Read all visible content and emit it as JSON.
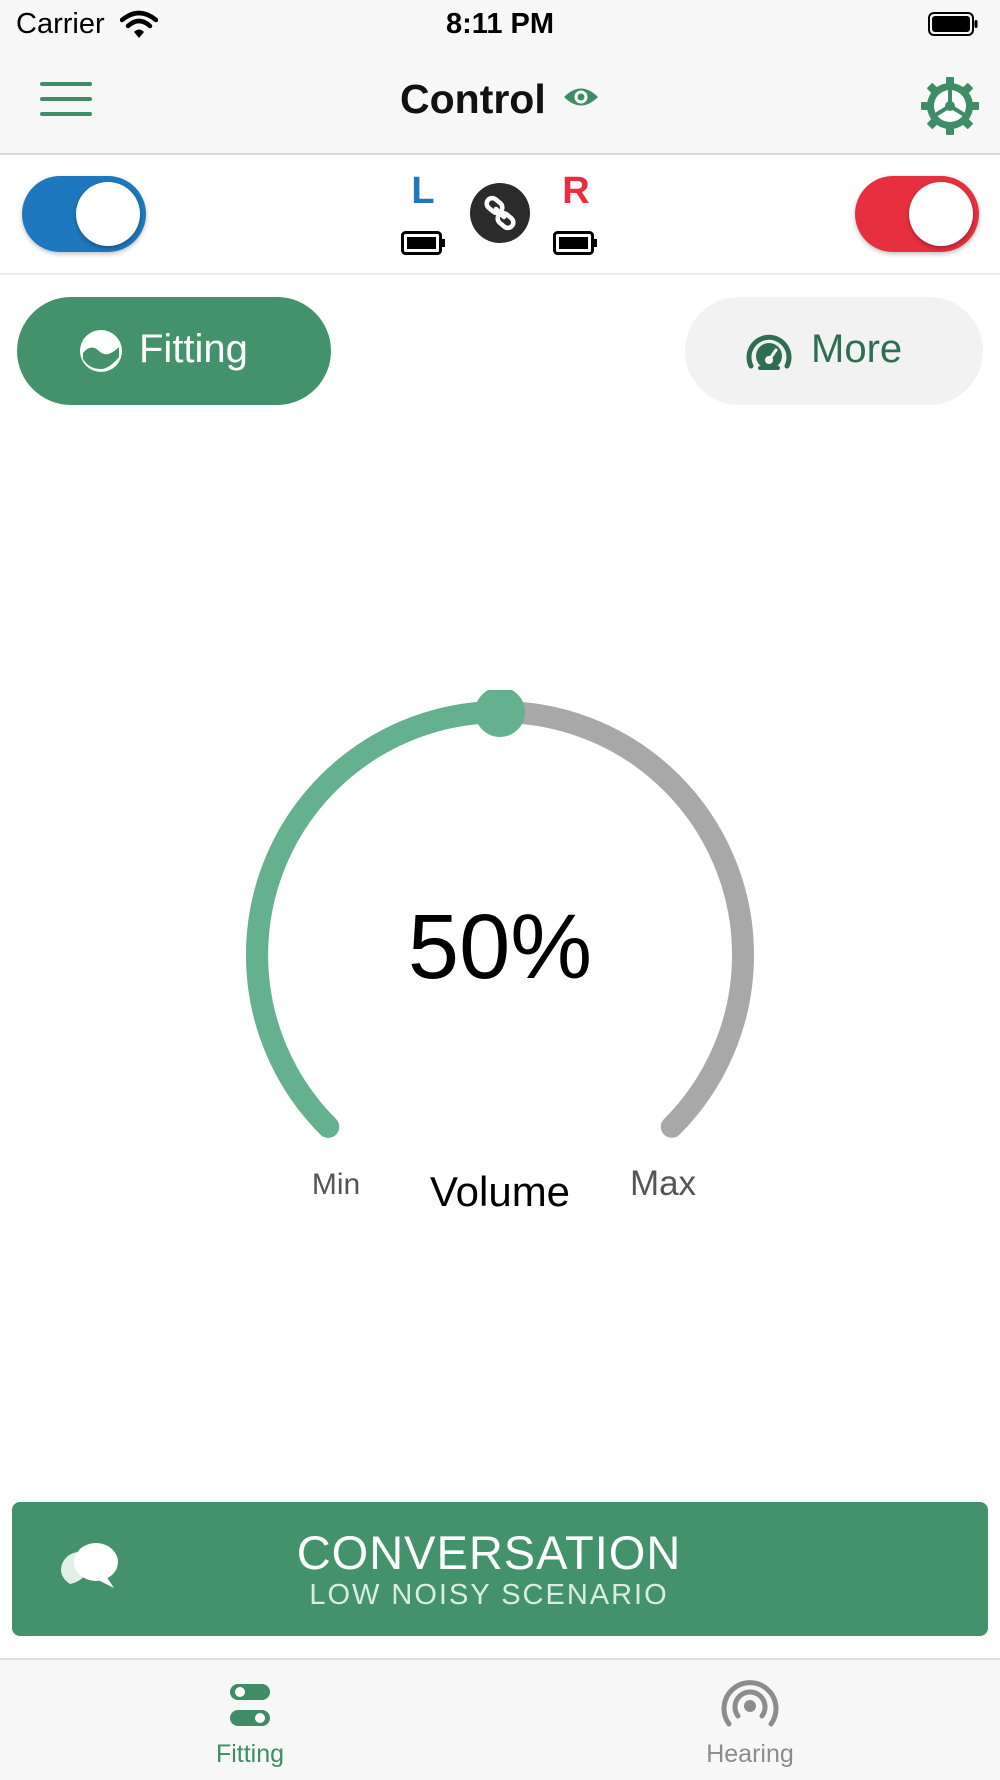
{
  "status_bar": {
    "carrier": "Carrier",
    "time": "8:11 PM"
  },
  "nav": {
    "title": "Control",
    "menu_icon": "hamburger-icon",
    "visibility_icon": "eye-icon",
    "settings_icon": "gear-icon",
    "accent": "#3e8d67"
  },
  "devices": {
    "left_label": "L",
    "right_label": "R",
    "left_enabled": true,
    "right_enabled": true,
    "left_color": "#1f77bd",
    "right_color": "#e6303f",
    "link_icon": "link-icon",
    "battery_icon": "battery-icon"
  },
  "modes": {
    "fitting_label": "Fitting",
    "fitting_icon": "wave-circle-icon",
    "more_label": "More",
    "more_icon": "speedometer-icon"
  },
  "volume": {
    "value_text": "50%",
    "level": 0.5,
    "min_label": "Min",
    "max_label": "Max",
    "label": "Volume",
    "active_color": "#64b08f",
    "track_color": "#a8a8a8"
  },
  "scenario": {
    "title": "CONVERSATION",
    "subtitle": "LOW NOISY SCENARIO",
    "icon": "chat-bubbles-icon",
    "color": "#43926b"
  },
  "tabs": [
    {
      "label": "Fitting",
      "icon": "sliders-icon",
      "active": true
    },
    {
      "label": "Hearing",
      "icon": "broadcast-icon",
      "active": false
    }
  ]
}
